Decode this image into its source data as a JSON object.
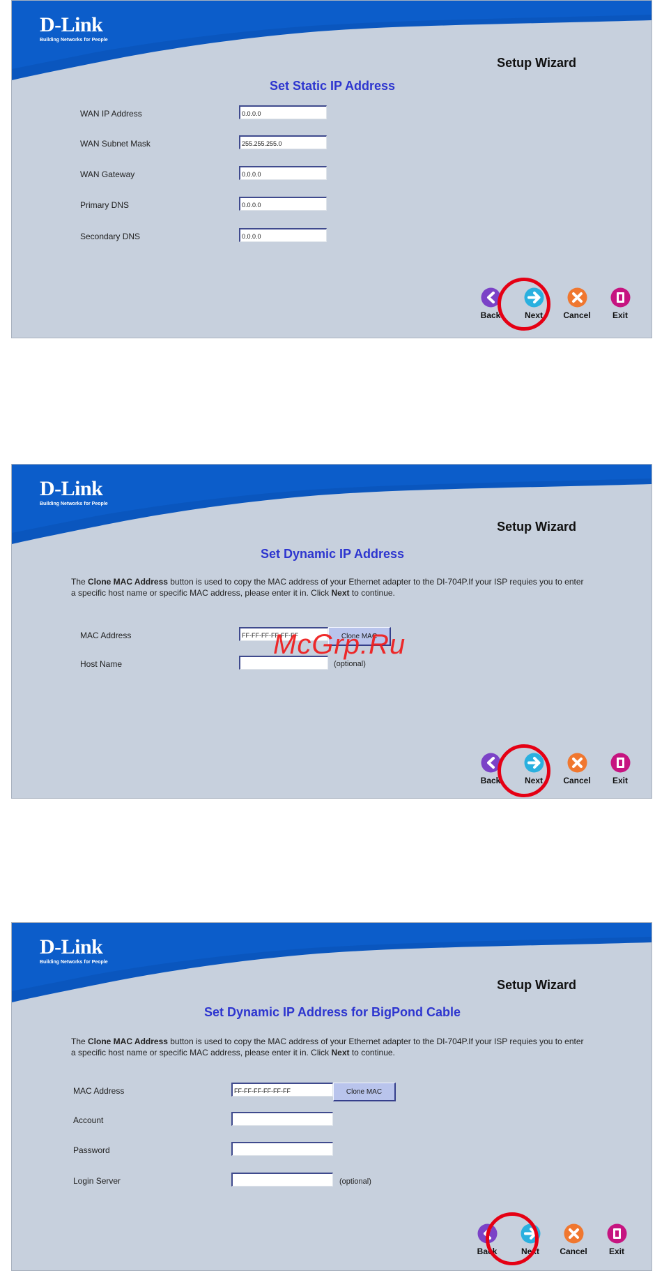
{
  "brand": {
    "logo_text": "D-Link",
    "tagline": "Building Networks for People"
  },
  "wizard_title": "Setup Wizard",
  "colors": {
    "title_blue": "#2d35cf",
    "header_blue": "#0a56be",
    "panel_bg": "#c7d0dd",
    "highlight_red": "#e50014"
  },
  "nav": {
    "back": "Back",
    "next": "Next",
    "cancel": "Cancel",
    "exit": "Exit",
    "icons": [
      "back-arrow-icon",
      "next-arrow-icon",
      "cancel-icon",
      "exit-icon"
    ]
  },
  "screen1": {
    "title": "Set Static IP Address",
    "fields": [
      {
        "label": "WAN IP Address",
        "value": "0.0.0.0"
      },
      {
        "label": "WAN Subnet Mask",
        "value": "255.255.255.0"
      },
      {
        "label": "WAN Gateway",
        "value": "0.0.0.0"
      },
      {
        "label": "Primary DNS",
        "value": "0.0.0.0"
      },
      {
        "label": "Secondary DNS",
        "value": "0.0.0.0"
      }
    ]
  },
  "screen2": {
    "title": "Set Dynamic IP Address",
    "description_prefix": "The ",
    "description_bold_1": "Clone MAC Address",
    "description_middle": " button is used to copy the MAC address of your Ethernet adapter to the DI-704P.If your ISP requies you to enter a specific host name or specific MAC address, please enter it in. Click ",
    "description_bold_2": "Next",
    "description_suffix": " to continue.",
    "fields": [
      {
        "label": "MAC Address",
        "value": "FF-FF-FF-FF-FF-FF"
      },
      {
        "label": "Host Name",
        "value": ""
      }
    ],
    "clone_button": "Clone MAC",
    "optional_text": "(optional)",
    "watermark": "McGrp.Ru"
  },
  "screen3": {
    "title": "Set Dynamic IP Address for BigPond Cable",
    "description_prefix": "The ",
    "description_bold_1": "Clone MAC Address",
    "description_middle": " button is used to copy the MAC address of your Ethernet adapter to the DI-704P.If your ISP requies you to enter a specific host name or specific MAC address, please enter it in. Click ",
    "description_bold_2": "Next",
    "description_suffix": " to continue.",
    "fields": [
      {
        "label": "MAC Address",
        "value": "FF-FF-FF-FF-FF-FF"
      },
      {
        "label": "Account",
        "value": ""
      },
      {
        "label": "Password",
        "value": ""
      },
      {
        "label": "Login Server",
        "value": ""
      }
    ],
    "clone_button": "Clone MAC",
    "optional_text": "(optional)"
  }
}
